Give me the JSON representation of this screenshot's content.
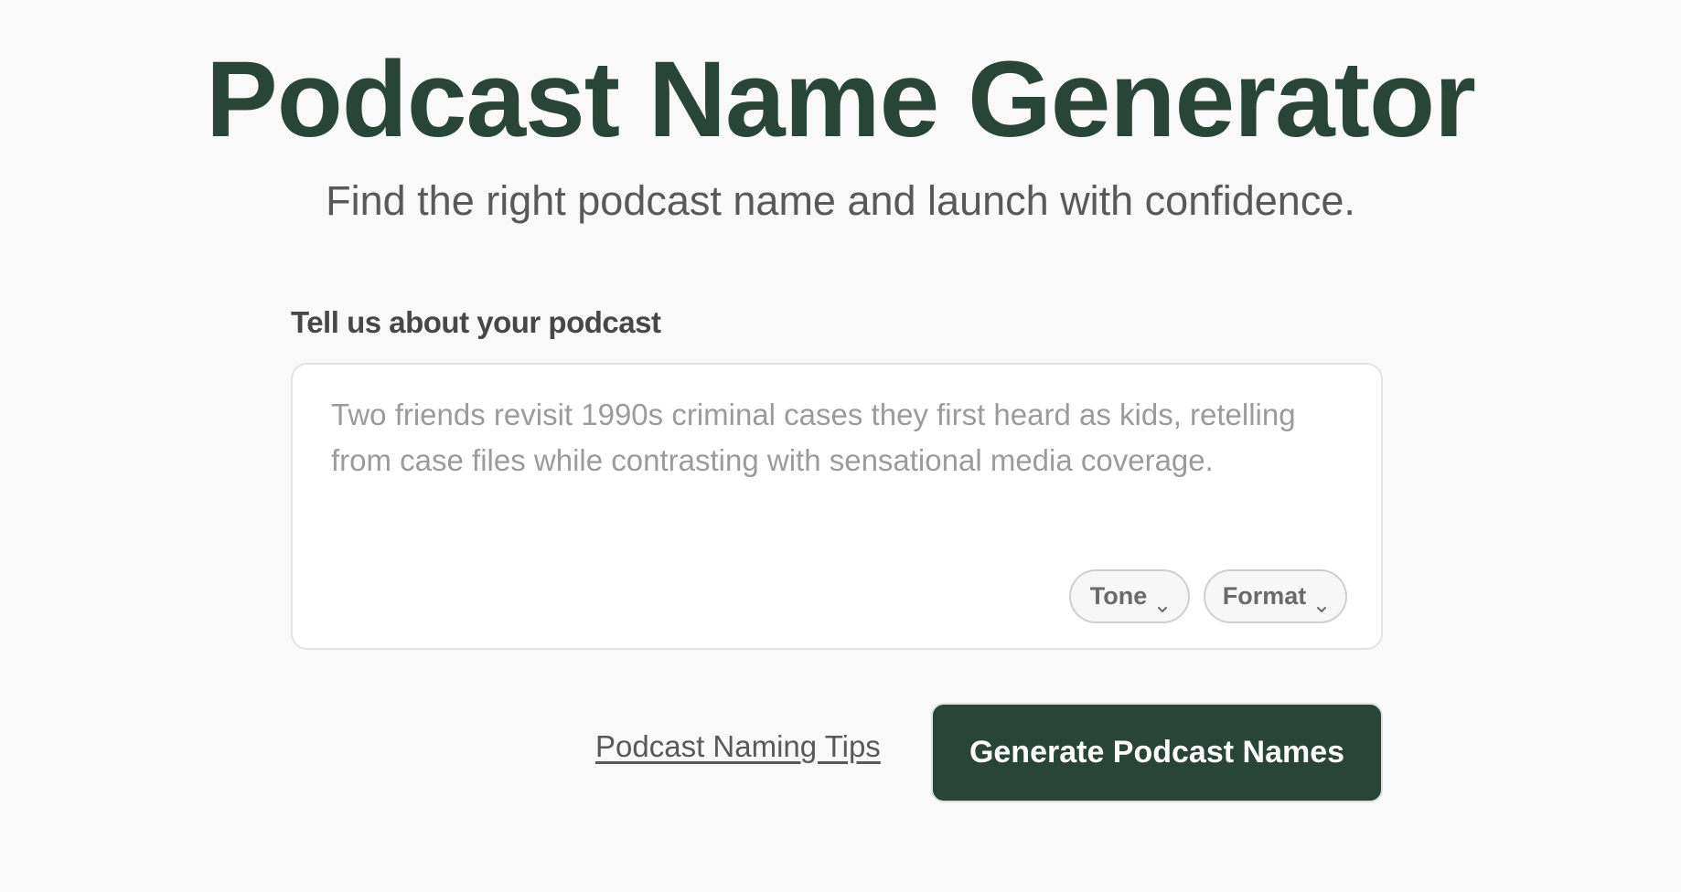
{
  "header": {
    "title": "Podcast Name Generator",
    "subtitle": "Find the right podcast name and launch with confidence."
  },
  "form": {
    "prompt_label": "Tell us about your podcast",
    "description": {
      "value": "",
      "placeholder": "Two friends revisit 1990s criminal cases they first heard as kids, retelling from case files while contrasting with sensational media coverage."
    },
    "tone": {
      "label": "Tone",
      "icon": "chevron-down-icon"
    },
    "format": {
      "label": "Format",
      "icon": "chevron-down-icon"
    }
  },
  "actions": {
    "tips_link": "Podcast Naming Tips",
    "generate_button": "Generate Podcast Names"
  },
  "colors": {
    "brand": "#284538",
    "background": "#f9f9f9",
    "text_muted": "#595959"
  }
}
